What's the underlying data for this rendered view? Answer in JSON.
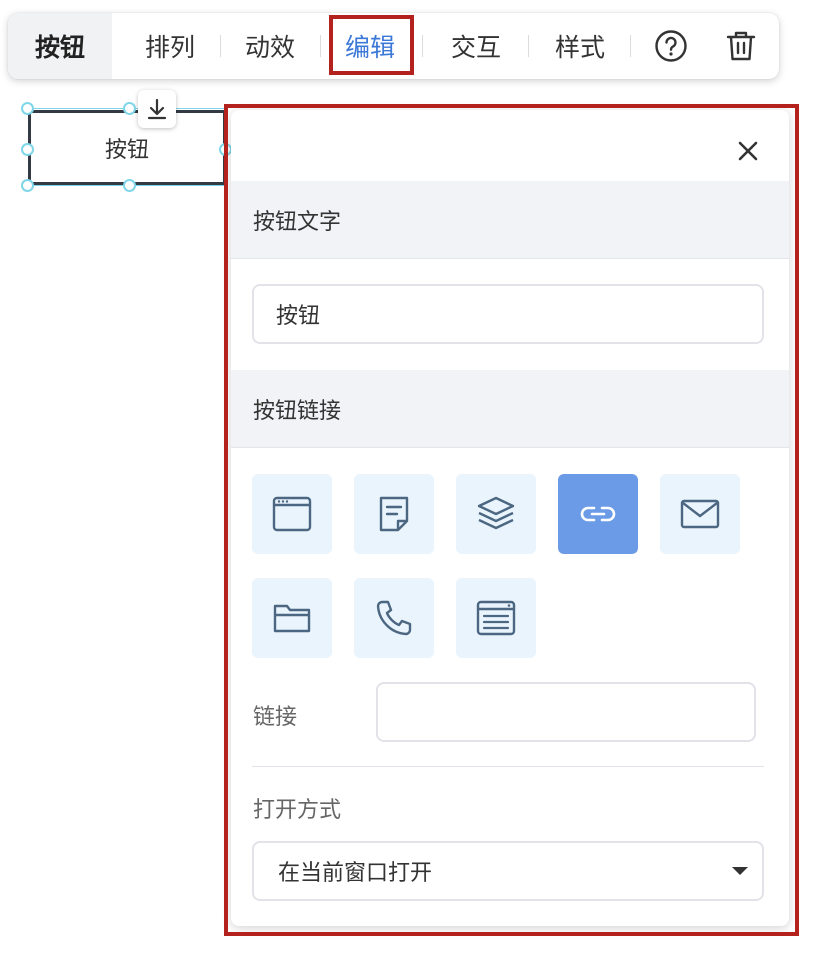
{
  "toolbar": {
    "items": [
      {
        "label": "按钮"
      },
      {
        "label": "排列"
      },
      {
        "label": "动效"
      },
      {
        "label": "编辑"
      },
      {
        "label": "交互"
      },
      {
        "label": "样式"
      }
    ],
    "help_icon": "help-circle-icon",
    "delete_icon": "trash-icon"
  },
  "canvas": {
    "button_label": "按钮",
    "drop_icon": "download-arrow-icon"
  },
  "panel": {
    "close_icon": "close-icon",
    "button_text_section": "按钮文字",
    "button_text_value": "按钮",
    "button_link_section": "按钮链接",
    "link_types": [
      {
        "icon": "browser-window-icon"
      },
      {
        "icon": "note-page-icon"
      },
      {
        "icon": "layers-icon"
      },
      {
        "icon": "link-icon",
        "selected": true
      },
      {
        "icon": "mail-icon"
      },
      {
        "icon": "folder-icon"
      },
      {
        "icon": "phone-icon"
      },
      {
        "icon": "list-window-icon"
      }
    ],
    "link_label": "链接",
    "link_value": "",
    "open_mode_label": "打开方式",
    "open_mode_value": "在当前窗口打开"
  },
  "colors": {
    "accent": "#3b78d8",
    "highlight": "#b3221d",
    "selected_tile": "#6b9be6",
    "tile_bg": "#eaf4fd"
  }
}
